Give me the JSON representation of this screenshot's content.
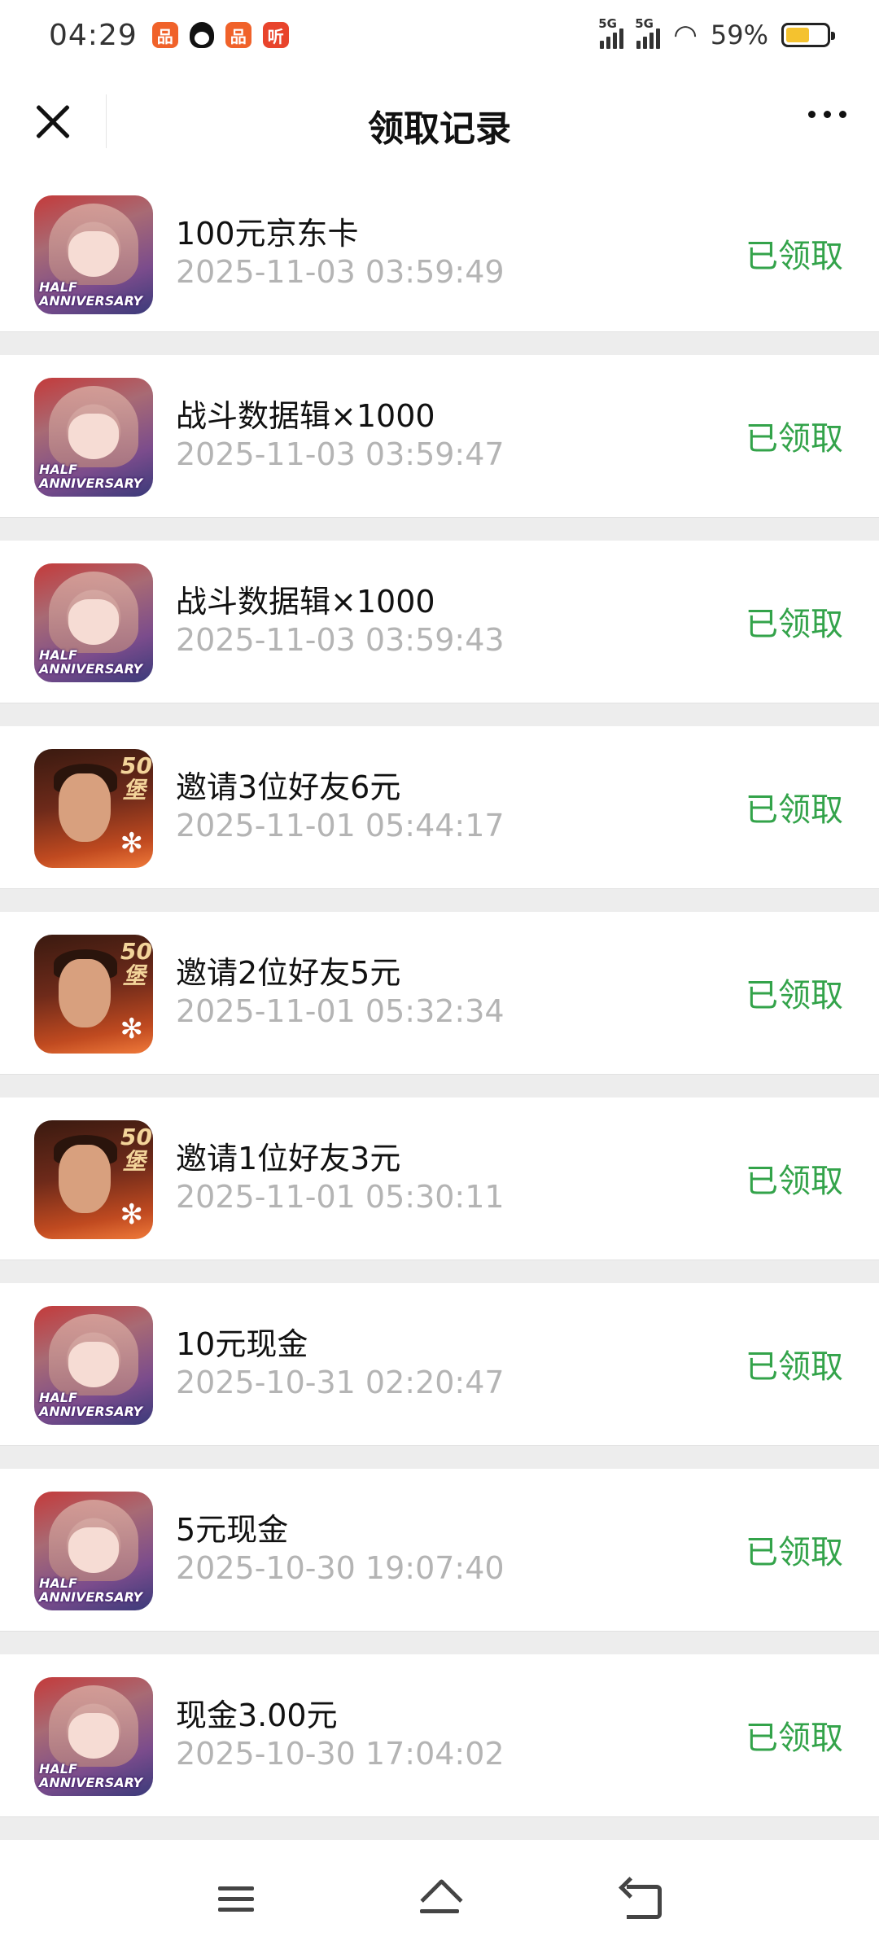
{
  "status_bar": {
    "time": "04:29",
    "app_icons": [
      {
        "name": "app-icon",
        "glyph": "品",
        "color": "#f0622a"
      },
      {
        "name": "qq-icon"
      },
      {
        "name": "app-icon",
        "glyph": "品",
        "color": "#f0622a"
      },
      {
        "name": "listen-icon",
        "glyph": "听",
        "color": "#e8442c"
      }
    ],
    "signal_1": "5G",
    "signal_2": "5G",
    "battery_percent_label": "59%",
    "battery_level": 0.59
  },
  "header": {
    "title": "领取记录"
  },
  "records": [
    {
      "title": "100元京东卡",
      "time": "2025-11-03 03:59:49",
      "status": "已领取",
      "icon": "anime",
      "badge": "HALF ANNIVERSARY"
    },
    {
      "title": "战斗数据辑×1000",
      "time": "2025-11-03 03:59:47",
      "status": "已领取",
      "icon": "anime",
      "badge": "HALF ANNIVERSARY"
    },
    {
      "title": "战斗数据辑×1000",
      "time": "2025-11-03 03:59:43",
      "status": "已领取",
      "icon": "anime",
      "badge": "HALF ANNIVERSARY"
    },
    {
      "title": "邀请3位好友6元",
      "time": "2025-11-01 05:44:17",
      "status": "已领取",
      "icon": "hero",
      "badge": "50堡"
    },
    {
      "title": "邀请2位好友5元",
      "time": "2025-11-01 05:32:34",
      "status": "已领取",
      "icon": "hero",
      "badge": "50堡"
    },
    {
      "title": "邀请1位好友3元",
      "time": "2025-11-01 05:30:11",
      "status": "已领取",
      "icon": "hero",
      "badge": "50堡"
    },
    {
      "title": "10元现金",
      "time": "2025-10-31 02:20:47",
      "status": "已领取",
      "icon": "anime",
      "badge": "HALF ANNIVERSARY"
    },
    {
      "title": "5元现金",
      "time": "2025-10-30 19:07:40",
      "status": "已领取",
      "icon": "anime",
      "badge": "HALF ANNIVERSARY"
    },
    {
      "title": "现金3.00元",
      "time": "2025-10-30 17:04:02",
      "status": "已领取",
      "icon": "anime",
      "badge": "HALF ANNIVERSARY"
    }
  ],
  "colors": {
    "status_green": "#33a34a",
    "time_gray": "#b4b4b4",
    "background": "#ededed"
  }
}
